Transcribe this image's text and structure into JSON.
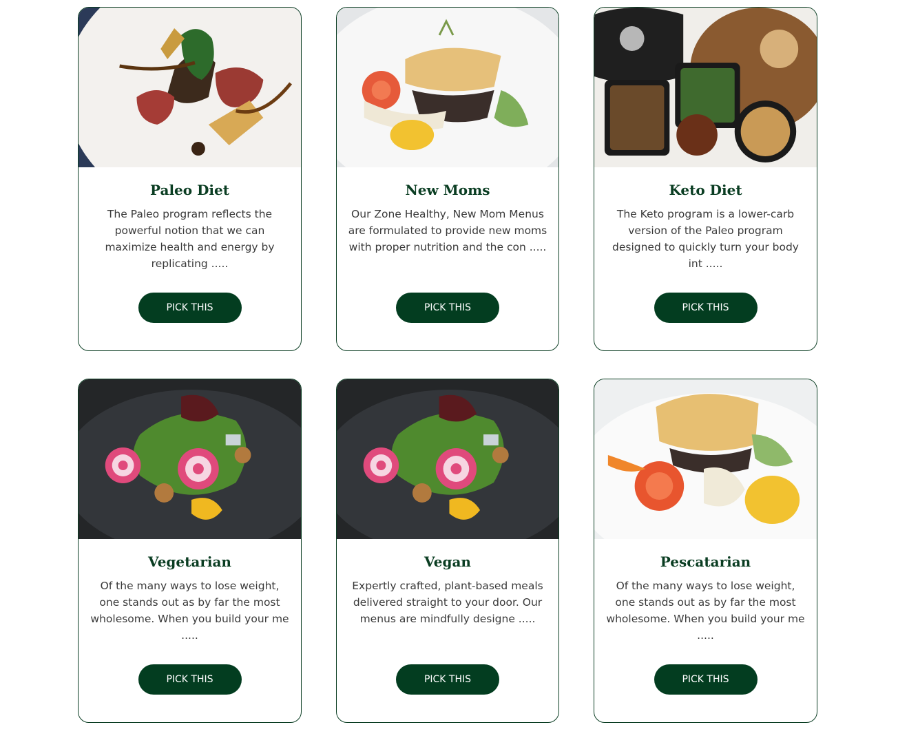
{
  "colors": {
    "brand_green": "#033d20",
    "border": "#0a3d22",
    "text": "#3a3a3a"
  },
  "cards": [
    {
      "title": "Paleo Diet",
      "description": "The Paleo program reflects the powerful notion that we can maximize health and energy by replicating .....",
      "button": "PICK THIS"
    },
    {
      "title": "New Moms",
      "description": "Our Zone Healthy, New Mom Menus are formulated to provide new moms with proper nutrition and the con .....",
      "button": "PICK THIS"
    },
    {
      "title": "Keto Diet",
      "description": "The Keto program is a lower-carb version of the Paleo program designed to quickly turn your body int .....",
      "button": "PICK THIS"
    },
    {
      "title": "Vegetarian",
      "description": "Of the many ways to lose weight, one stands out as by far the most wholesome. When you build your me .....",
      "button": "PICK THIS"
    },
    {
      "title": "Vegan",
      "description": "Expertly crafted, plant-based meals delivered straight to your door. Our menus are mindfully designe .....",
      "button": "PICK THIS"
    },
    {
      "title": "Pescatarian",
      "description": "Of the many ways to lose weight, one stands out as by far the most wholesome. When you build your me .....",
      "button": "PICK THIS"
    }
  ]
}
